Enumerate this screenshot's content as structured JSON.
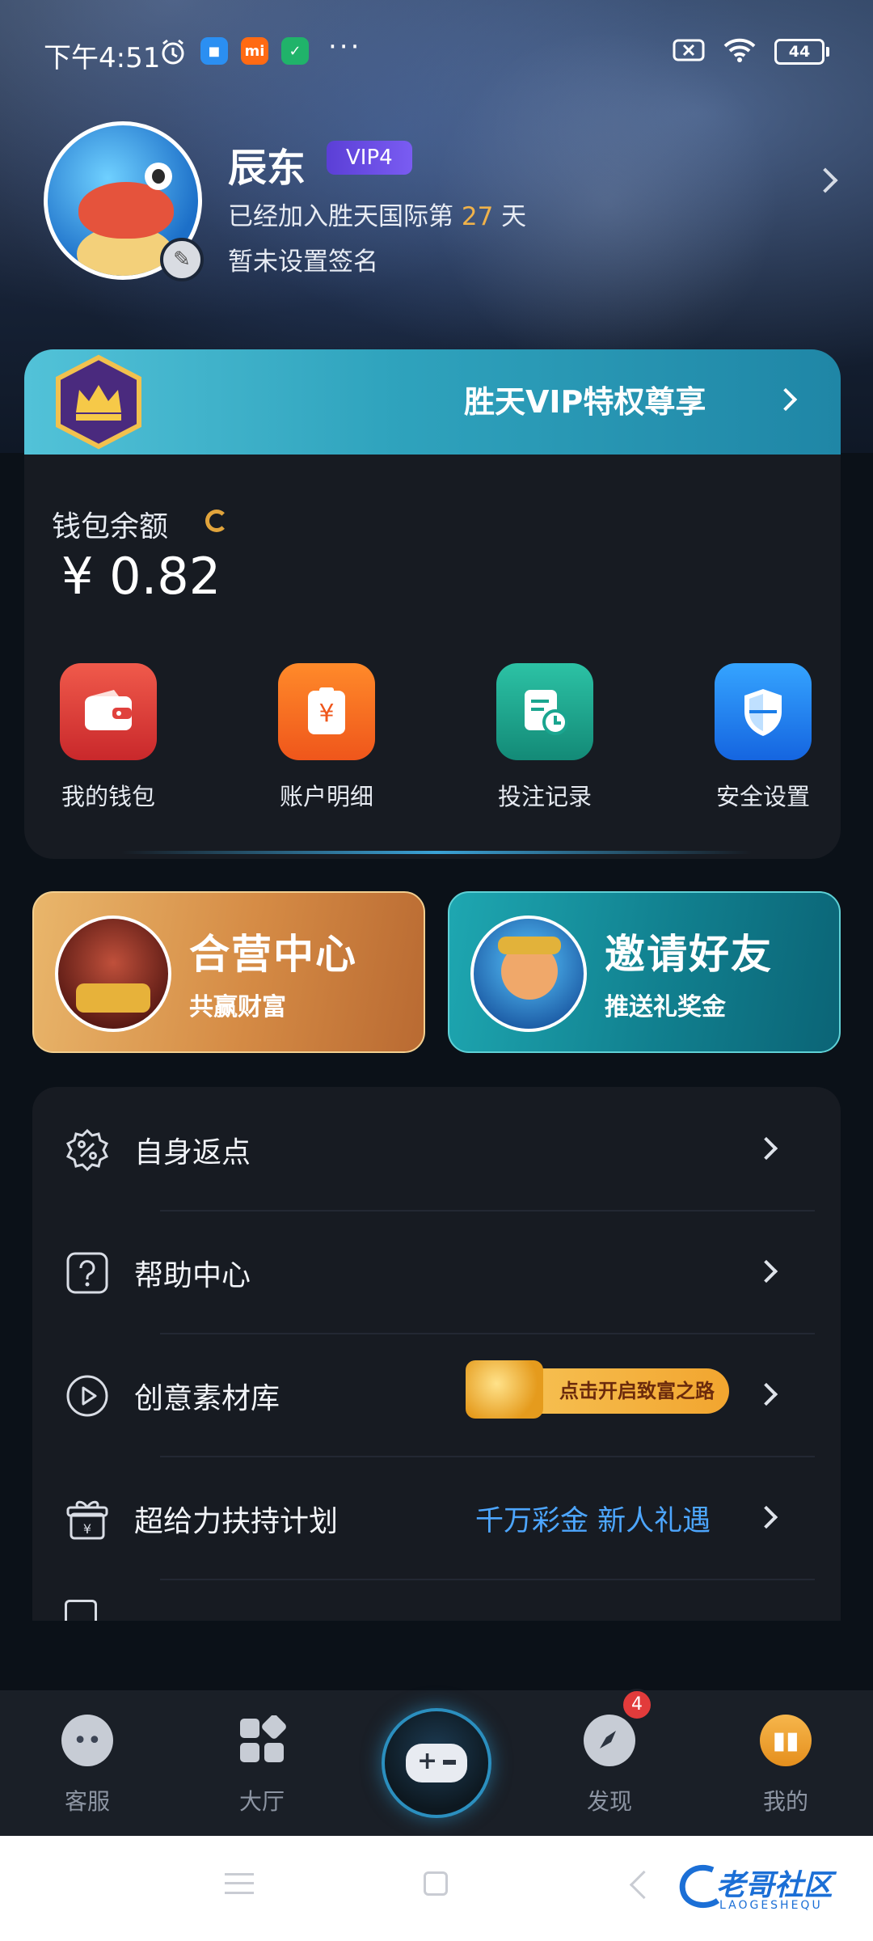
{
  "status_bar": {
    "time": "下午4:51",
    "battery": "44",
    "apps": [
      "mi"
    ]
  },
  "profile": {
    "name": "辰东",
    "vip_level": "VIP4",
    "joined_prefix": "已经加入胜天国际第",
    "joined_days": "27",
    "joined_suffix": "天",
    "signature": "暂未设置签名"
  },
  "vip_banner": {
    "text": "胜天VIP特权尊享"
  },
  "wallet": {
    "label": "钱包余额",
    "balance": "¥ 0.82"
  },
  "quick_actions": [
    {
      "label": "我的钱包",
      "icon": "wallet-icon",
      "color": "#e0413d"
    },
    {
      "label": "账户明细",
      "icon": "receipt-icon",
      "color": "#f36a21"
    },
    {
      "label": "投注记录",
      "icon": "record-icon",
      "color": "#1aa58f"
    },
    {
      "label": "安全设置",
      "icon": "shield-icon",
      "color": "#1a7de8"
    }
  ],
  "promos": [
    {
      "title": "合营中心",
      "subtitle": "共赢财富"
    },
    {
      "title": "邀请好友",
      "subtitle": "推送礼奖金"
    }
  ],
  "menu": [
    {
      "label": "自身返点",
      "icon": "percent-badge-icon"
    },
    {
      "label": "帮助中心",
      "icon": "question-icon"
    },
    {
      "label": "创意素材库",
      "icon": "play-circle-icon",
      "pill": "点击开启致富之路"
    },
    {
      "label": "超给力扶持计划",
      "icon": "gift-icon",
      "extra": "千万彩金 新人礼遇"
    }
  ],
  "bottom_nav": [
    {
      "label": "客服",
      "icon": "chat-icon"
    },
    {
      "label": "大厅",
      "icon": "grid-icon"
    },
    {
      "label": "",
      "icon": "gamepad-icon"
    },
    {
      "label": "发现",
      "icon": "compass-icon",
      "badge": "4"
    },
    {
      "label": "我的",
      "icon": "profile-icon"
    }
  ],
  "watermark": {
    "text": "老哥社区",
    "sub": "LAOGESHEQU"
  }
}
